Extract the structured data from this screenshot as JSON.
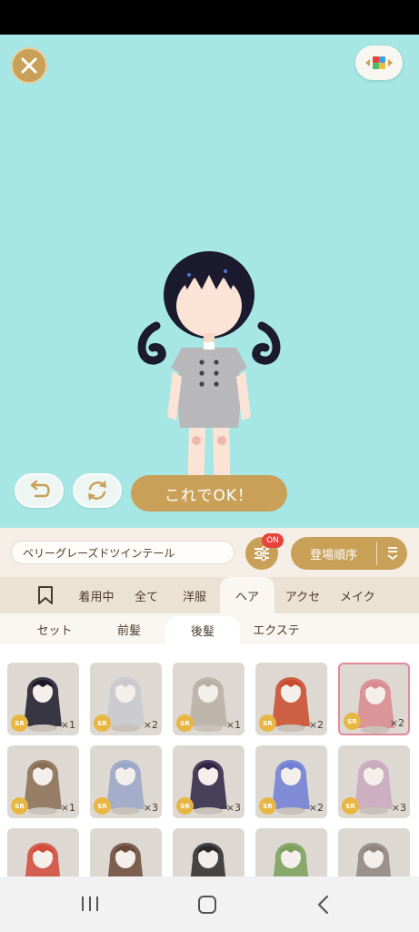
{
  "stage": {
    "confirm_label": "これでOK！"
  },
  "filter": {
    "item_name": "ベリーグレーズドツインテール",
    "on_badge": "ON",
    "sort_label": "登場順序"
  },
  "categories": [
    {
      "label": "",
      "icon": "bookmark-icon"
    },
    {
      "label": "着用中"
    },
    {
      "label": "全て"
    },
    {
      "label": "洋服"
    },
    {
      "label": "ヘア",
      "active": true
    },
    {
      "label": "アクセ"
    },
    {
      "label": "メイク"
    }
  ],
  "subcategories": [
    {
      "label": "セット"
    },
    {
      "label": "前髪"
    },
    {
      "label": "後髪",
      "active": true
    },
    {
      "label": "エクステ"
    }
  ],
  "items": [
    {
      "rarity": "SR",
      "qty": "×1",
      "hair": "#1c1a2a"
    },
    {
      "rarity": "SR",
      "qty": "×2",
      "hair": "#c9c9cf"
    },
    {
      "rarity": "SR",
      "qty": "×1",
      "hair": "#b9afa5"
    },
    {
      "rarity": "SR",
      "qty": "×2",
      "hair": "#c94a2c"
    },
    {
      "rarity": "SR",
      "qty": "×2",
      "hair": "#d9898f",
      "selected": true
    },
    {
      "rarity": "SR",
      "qty": "×1",
      "hair": "#8a6d52"
    },
    {
      "rarity": "SR",
      "qty": "×3",
      "hair": "#9aa6c9"
    },
    {
      "rarity": "SR",
      "qty": "×3",
      "hair": "#2e2546"
    },
    {
      "rarity": "SR",
      "qty": "×2",
      "hair": "#6f7fd6"
    },
    {
      "rarity": "SR",
      "qty": "×3",
      "hair": "#c9a9bf"
    },
    {
      "rarity": "",
      "qty": "",
      "hair": "#d24a3a"
    },
    {
      "rarity": "",
      "qty": "",
      "hair": "#6b4a3a"
    },
    {
      "rarity": "",
      "qty": "",
      "hair": "#2a2a2a"
    },
    {
      "rarity": "",
      "qty": "",
      "hair": "#7aa05a"
    },
    {
      "rarity": "",
      "qty": "",
      "hair": "#8d857e"
    }
  ],
  "colors": {
    "accent": "#c9a058",
    "stage_bg": "#a6e6e4",
    "badge_red": "#e5433b",
    "sr_badge": "#e8b743"
  }
}
